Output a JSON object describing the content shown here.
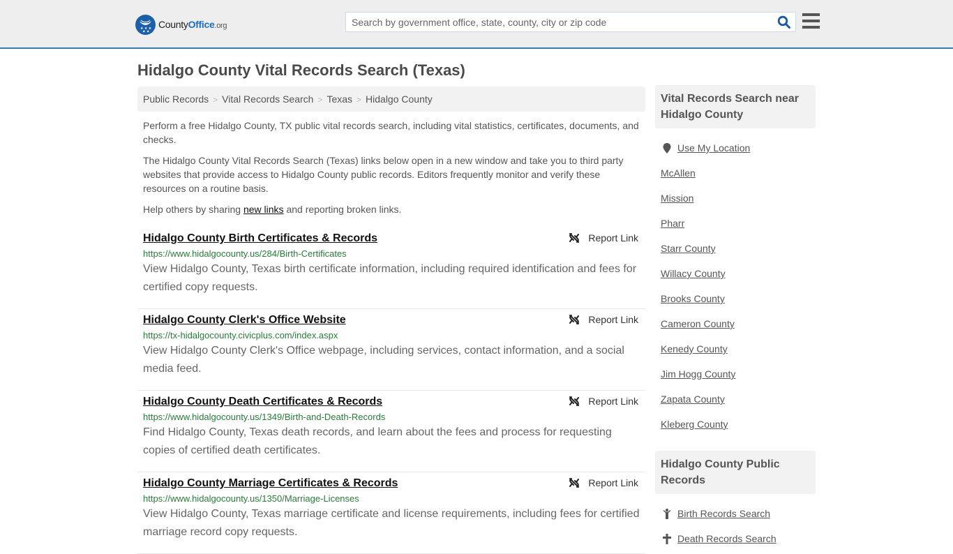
{
  "header": {
    "logo": {
      "county": "County",
      "office": "Office",
      "org": ".org"
    },
    "search": {
      "placeholder": "Search by government office, state, county, city or zip code",
      "value": ""
    },
    "icons": {
      "search": "search-icon",
      "menu": "hamburger-menu-icon"
    }
  },
  "page": {
    "title": "Hidalgo County Vital Records Search (Texas)"
  },
  "breadcrumb": [
    {
      "label": "Public Records"
    },
    {
      "label": "Vital Records Search"
    },
    {
      "label": "Texas"
    },
    {
      "label": "Hidalgo County"
    }
  ],
  "intro": {
    "p1": "Perform a free Hidalgo County, TX public vital records search, including vital statistics, certificates, documents, and checks.",
    "p2": "The Hidalgo County Vital Records Search (Texas) links below open in a new window and take you to third party websites that provide access to Hidalgo County public records. Editors frequently monitor and verify these resources on a routine basis.",
    "p3_before": "Help others by sharing ",
    "p3_link": "new links",
    "p3_after": " and reporting broken links."
  },
  "results": [
    {
      "title": "Hidalgo County Birth Certificates & Records",
      "url": "https://www.hidalgocounty.us/284/Birth-Certificates",
      "description": "View Hidalgo County, Texas birth certificate information, including required identification and fees for certified copy requests.",
      "report_label": "Report Link"
    },
    {
      "title": "Hidalgo County Clerk's Office Website",
      "url": "https://tx-hidalgocounty.civicplus.com/index.aspx",
      "description": "View Hidalgo County Clerk's Office webpage, including services, contact information, and a social media feed.",
      "report_label": "Report Link"
    },
    {
      "title": "Hidalgo County Death Certificates & Records",
      "url": "https://www.hidalgocounty.us/1349/Birth-and-Death-Records",
      "description": "Find Hidalgo County, Texas death records, and learn about the fees and process for requesting copies of certified death certificates.",
      "report_label": "Report Link"
    },
    {
      "title": "Hidalgo County Marriage Certificates & Records",
      "url": "https://www.hidalgocounty.us/1350/Marriage-Licenses",
      "description": "View Hidalgo County, Texas marriage certificate and license requirements, including fees for certified marriage record copy requests.",
      "report_label": "Report Link"
    }
  ],
  "sidebar": {
    "nearby": {
      "heading": "Vital Records Search near Hidalgo County",
      "use_location": "Use My Location",
      "items": [
        "McAllen",
        "Mission",
        "Pharr",
        "Starr County",
        "Willacy County",
        "Brooks County",
        "Cameron County",
        "Kenedy County",
        "Jim Hogg County",
        "Zapata County",
        "Kleberg County"
      ]
    },
    "public_records": {
      "heading": "Hidalgo County Public Records",
      "items": [
        {
          "label": "Birth Records Search",
          "icon": "child-icon"
        },
        {
          "label": "Death Records Search",
          "icon": "cross-icon"
        }
      ]
    }
  },
  "colors": {
    "header_bg": "#eeeeee",
    "header_border": "#3a7aa9",
    "brand_blue": "#1b5fa8",
    "url_green": "#2b7a3b"
  }
}
